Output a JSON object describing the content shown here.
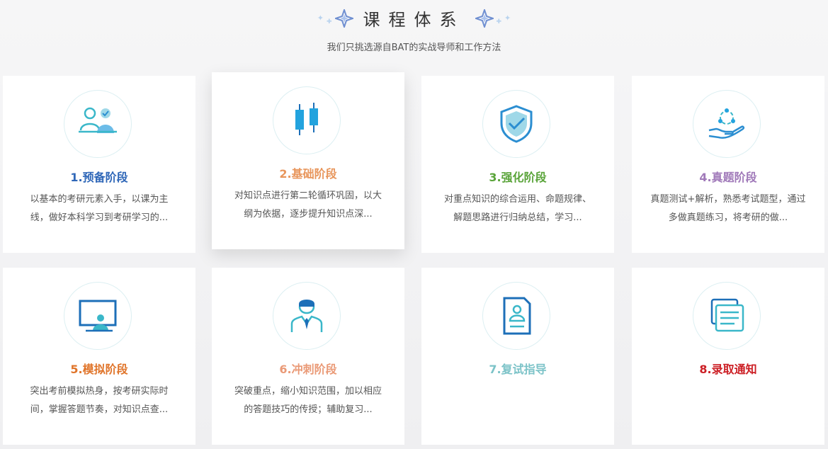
{
  "header": {
    "title": "课程体系",
    "subtitle": "我们只挑选源自BAT的实战导师和工作方法"
  },
  "cards": [
    {
      "title": "1.预备阶段",
      "desc": "以基本的考研元素入手，以课为主线，做好本科学习到考研学习的...",
      "color": "#2f67b8",
      "icon": "people-icon"
    },
    {
      "title": "2.基础阶段",
      "desc": "对知识点进行第二轮循环巩固，以大纲为依据，逐步提升知识点深...",
      "color": "#e8965c",
      "icon": "candlestick-icon"
    },
    {
      "title": "3.强化阶段",
      "desc": "对重点知识的综合运用、命题规律、解题思路进行归纳总结，学习...",
      "color": "#5aa43a",
      "icon": "shield-check-icon"
    },
    {
      "title": "4.真题阶段",
      "desc": "真题测试+解析，熟悉考试题型，通过多做真题练习，将考研的做...",
      "color": "#a079b9",
      "icon": "hand-network-icon"
    },
    {
      "title": "5.模拟阶段",
      "desc": "突出考前模拟热身，按考研实际时间，掌握答题节奏，对知识点查...",
      "color": "#e0752b",
      "icon": "presentation-icon"
    },
    {
      "title": "6.冲刺阶段",
      "desc": "突破重点，缩小知识范围，加以相应的答题技巧的传授；辅助复习...",
      "color": "#ea9a77",
      "icon": "businessman-icon"
    },
    {
      "title": "7.复试指导",
      "desc": "",
      "color": "#7cc3c8",
      "icon": "resume-icon"
    },
    {
      "title": "8.录取通知",
      "desc": "",
      "color": "#cc1f25",
      "icon": "documents-icon"
    }
  ]
}
